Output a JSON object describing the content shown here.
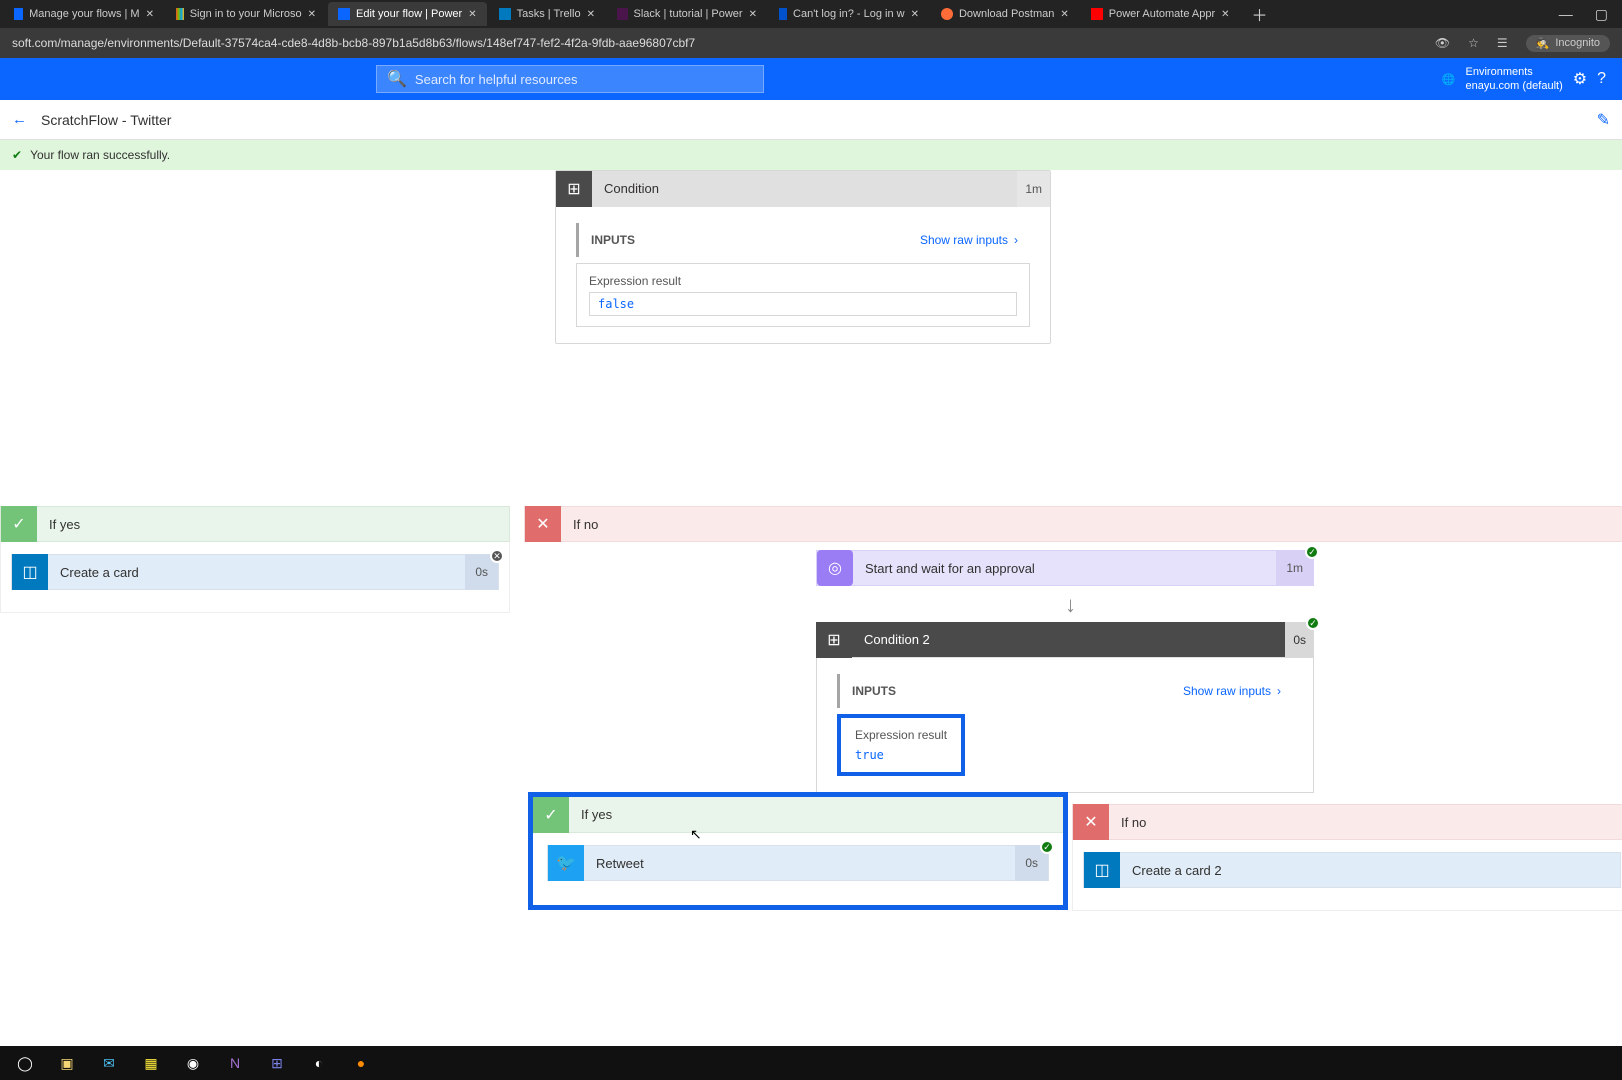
{
  "browser": {
    "tabs": [
      {
        "label": "Manage your flows | M"
      },
      {
        "label": "Sign in to your Microso"
      },
      {
        "label": "Edit your flow | Power"
      },
      {
        "label": "Tasks | Trello"
      },
      {
        "label": "Slack | tutorial | Power"
      },
      {
        "label": "Can't log in? - Log in w"
      },
      {
        "label": "Download Postman"
      },
      {
        "label": "Power Automate Appr"
      }
    ],
    "url": "soft.com/manage/environments/Default-37574ca4-cde8-4d8b-bcb8-897b1a5d8b63/flows/148ef747-fef2-4f2a-9fdb-aae96807cbf7",
    "incognito": "Incognito"
  },
  "header": {
    "search_placeholder": "Search for helpful resources",
    "env_label": "Environments",
    "env_value": "enayu.com (default)"
  },
  "subheader": {
    "flow_name": "ScratchFlow - Twitter"
  },
  "banner": {
    "message": "Your flow ran successfully."
  },
  "cond1": {
    "title": "Condition",
    "duration": "1m",
    "inputs_label": "INPUTS",
    "raw_link": "Show raw inputs",
    "expr_label": "Expression result",
    "expr_value": "false"
  },
  "ifyes1": {
    "title": "If yes",
    "action_title": "Create a card",
    "duration": "0s"
  },
  "ifno1": {
    "title": "If no"
  },
  "approval": {
    "title": "Start and wait for an approval",
    "duration": "1m"
  },
  "cond2": {
    "title": "Condition 2",
    "duration": "0s",
    "inputs_label": "INPUTS",
    "raw_link": "Show raw inputs",
    "expr_label": "Expression result",
    "expr_value": "true"
  },
  "ifyes2": {
    "title": "If yes",
    "action_title": "Retweet",
    "duration": "0s"
  },
  "ifno2": {
    "title": "If no",
    "action_title": "Create a card 2"
  }
}
